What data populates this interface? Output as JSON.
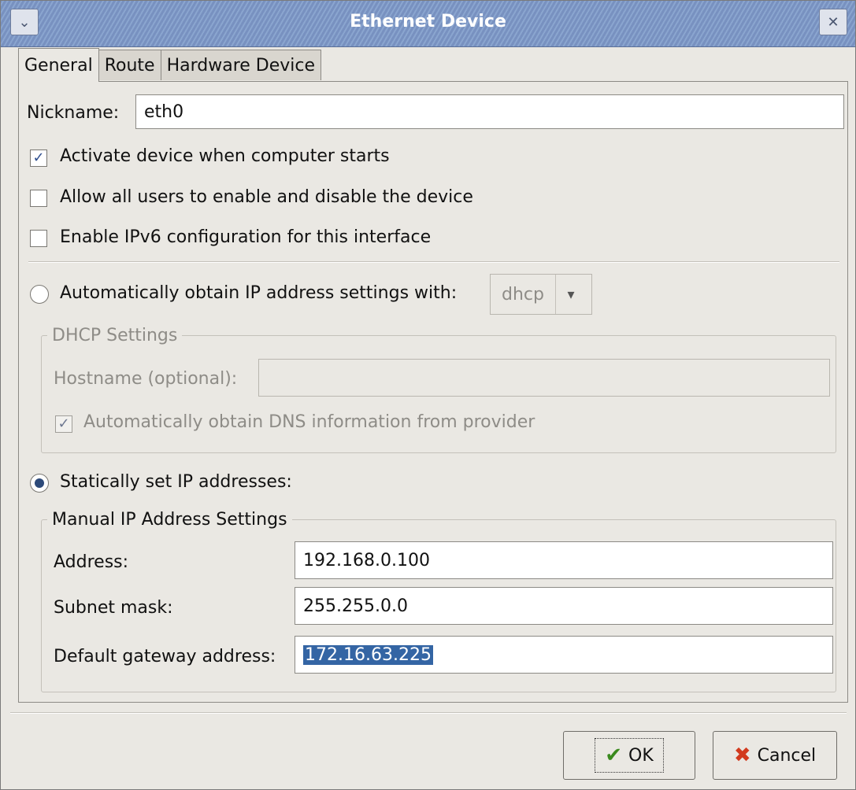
{
  "window": {
    "title": "Ethernet Device"
  },
  "tabs": [
    {
      "label": "General"
    },
    {
      "label": "Route"
    },
    {
      "label": "Hardware Device"
    }
  ],
  "general": {
    "nickname_label": "Nickname:",
    "nickname_value": "eth0",
    "activate_label": "Activate device when computer starts",
    "activate_checked": true,
    "allow_users_label": "Allow all users to enable and disable the device",
    "allow_users_checked": false,
    "ipv6_label": "Enable IPv6 configuration for this interface",
    "ipv6_checked": false,
    "auto_ip_label": "Automatically obtain IP address settings with:",
    "auto_ip_selected": false,
    "auto_ip_method": "dhcp",
    "dhcp": {
      "title": "DHCP Settings",
      "hostname_label": "Hostname (optional):",
      "hostname_value": "",
      "dns_label": "Automatically obtain DNS information from provider",
      "dns_checked": true
    },
    "static_label": "Statically set IP addresses:",
    "static_selected": true,
    "manual": {
      "title": "Manual IP Address Settings",
      "address_label": "Address:",
      "address_value": "192.168.0.100",
      "subnet_label": "Subnet mask:",
      "subnet_value": "255.255.0.0",
      "gateway_label": "Default gateway address:",
      "gateway_value": "172.16.63.225"
    }
  },
  "buttons": {
    "ok": "OK",
    "cancel": "Cancel"
  },
  "icons": {
    "menu": "chevron-down-icon",
    "close": "close-icon",
    "ok": "checkmark-icon",
    "cancel": "x-icon"
  }
}
